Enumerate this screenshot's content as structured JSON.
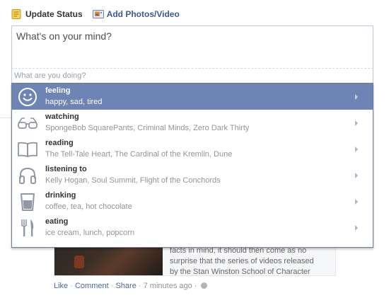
{
  "composer": {
    "tabs": [
      {
        "label": "Update Status",
        "icon": "status-note-icon"
      },
      {
        "label": "Add Photos/Video",
        "icon": "photo-icon"
      }
    ],
    "placeholder": "What's on your mind?",
    "activity_placeholder": "What are you doing?"
  },
  "activity_menu": {
    "items": [
      {
        "title": "feeling",
        "examples": "happy, sad, tired",
        "icon": "smiley-icon",
        "selected": true
      },
      {
        "title": "watching",
        "examples": "SpongeBob SquarePants, Criminal Minds, Zero Dark Thirty",
        "icon": "glasses-icon",
        "selected": false
      },
      {
        "title": "reading",
        "examples": "The Tell-Tale Heart, The Cardinal of the Kremlin, Dune",
        "icon": "book-icon",
        "selected": false
      },
      {
        "title": "listening to",
        "examples": "Kelly Hogan, Soul Summit, Flight of the Conchords",
        "icon": "headphones-icon",
        "selected": false
      },
      {
        "title": "drinking",
        "examples": "coffee, tea, hot chocolate",
        "icon": "cup-icon",
        "selected": false
      },
      {
        "title": "eating",
        "examples": "ice cream, lunch, popcorn",
        "icon": "fork-knife-icon",
        "selected": false
      }
    ]
  },
  "feed_post": {
    "snippet_lines": [
      "facts in mind, it should then come as no",
      "surprise that the series of videos released",
      "by the Stan Winston School of Character"
    ],
    "actions": {
      "like": "Like",
      "comment": "Comment",
      "share": "Share",
      "time": "7 minutes ago"
    }
  },
  "colors": {
    "selected_bg": "#6d84b4",
    "link": "#3b5998"
  }
}
